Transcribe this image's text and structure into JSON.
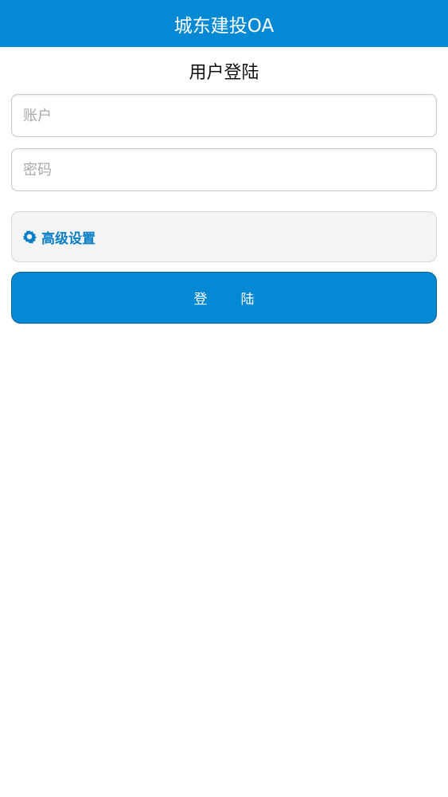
{
  "header": {
    "title": "城东建投OA"
  },
  "login": {
    "title": "用户登陆",
    "account_placeholder": "账户",
    "password_placeholder": "密码",
    "advanced_label": "高级设置",
    "advanced_icon": "gear-icon",
    "submit_label": "登陆"
  },
  "colors": {
    "accent": "#0689d4",
    "link": "#0a7fc6",
    "panel_bg": "#f4f4f5"
  }
}
